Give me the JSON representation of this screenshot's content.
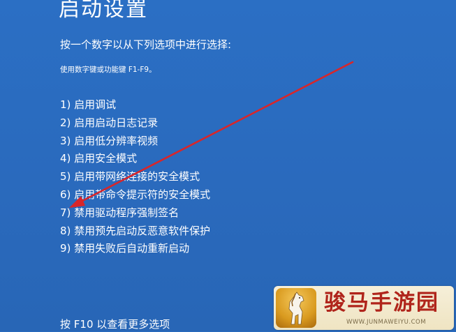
{
  "window": {
    "title": "启动设置"
  },
  "instructions": {
    "prompt": "按一个数字以从下列选项中进行选择:",
    "hint": "使用数字键或功能键 F1-F9。"
  },
  "options": [
    {
      "label": "1) 启用调试"
    },
    {
      "label": "2) 启用启动日志记录"
    },
    {
      "label": "3) 启用低分辨率视频"
    },
    {
      "label": "4) 启用安全模式"
    },
    {
      "label": "5) 启用带网络连接的安全模式"
    },
    {
      "label": "6) 启用带命令提示符的安全模式"
    },
    {
      "label": "7) 禁用驱动程序强制签名"
    },
    {
      "label": "8) 禁用预先启动反恶意软件保护"
    },
    {
      "label": "9) 禁用失败后自动重新启动"
    }
  ],
  "footer": {
    "more_options": "按 F10 以查看更多选项"
  },
  "annotation": {
    "icon": "red-arrow-icon",
    "color": "#d8262a",
    "points_to_option": 7
  },
  "watermark": {
    "title": "骏马手游园",
    "url": "WWW.JUNMAWEIYU.COM",
    "icon": "horse-logo-icon"
  },
  "colors": {
    "background": "#2a6cbf",
    "text": "#ffffff"
  }
}
